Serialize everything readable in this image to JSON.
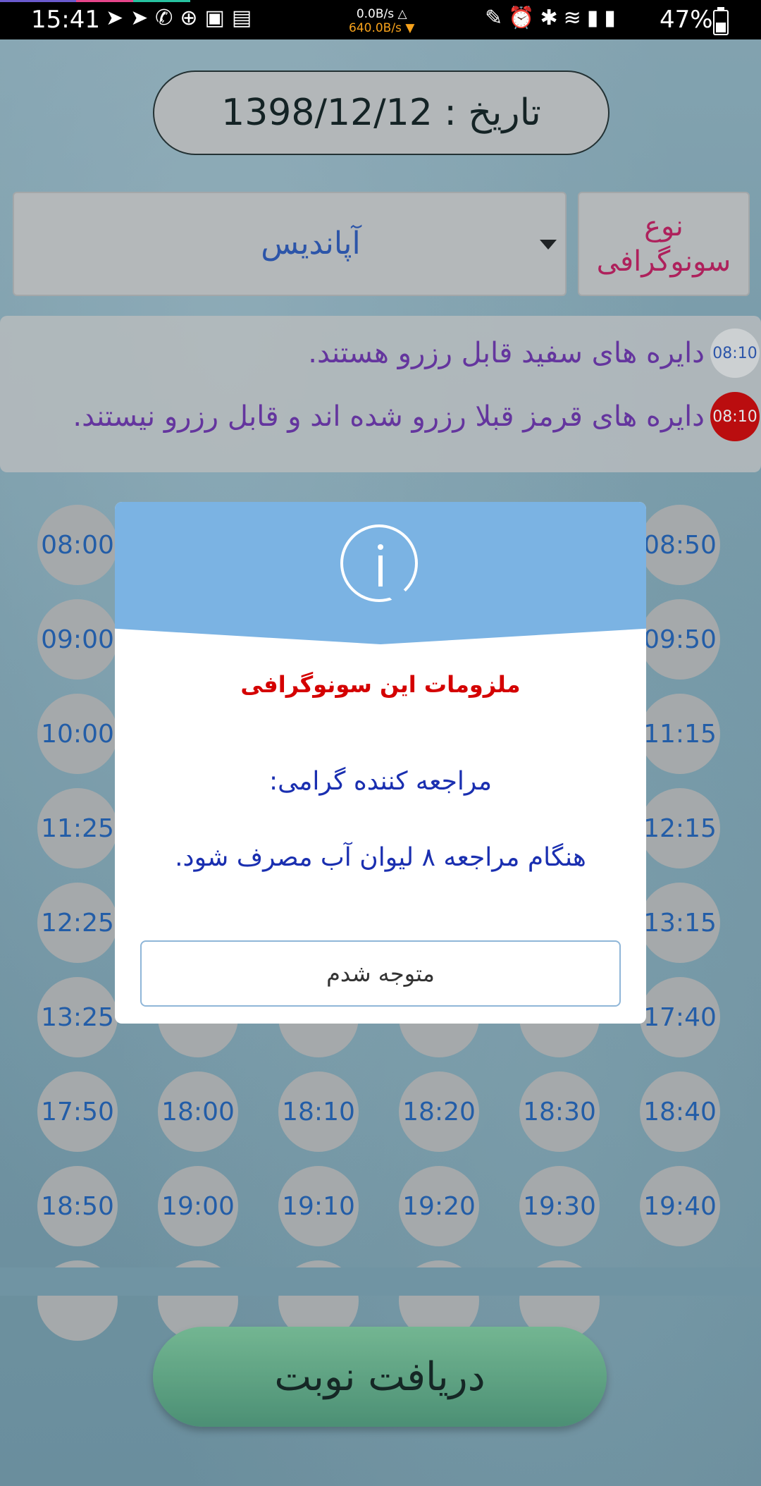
{
  "status_bar": {
    "time": "15:41",
    "left_icons": "➤➤✆⊕▣▤",
    "upload_speed": "0.0B/s △",
    "download_speed": "640.0B/s ▼",
    "right_icons": "✎⏰✱≋▮▮",
    "battery": "47%"
  },
  "header": {
    "date_label": "تاریخ : 1398/12/12"
  },
  "selector": {
    "type_label_line1": "نوع",
    "type_label_line2": "سونوگرافی",
    "selected_value": "آپاندیس"
  },
  "legend": {
    "white_sample_time": "08:10",
    "white_text": "دایره های سفید قابل رزرو هستند.",
    "red_sample_time": "08:10",
    "red_text": "دایره های قرمز قبلا رزرو شده اند و قابل رزرو نیستند.",
    "colors": {
      "available": "#e6e6e6",
      "reserved": "#d10000"
    }
  },
  "time_slots": [
    [
      "08:00",
      "",
      "",
      "",
      "",
      "08:50"
    ],
    [
      "09:00",
      "",
      "",
      "",
      "",
      "09:50"
    ],
    [
      "10:00",
      "",
      "",
      "",
      "",
      "11:15"
    ],
    [
      "11:25",
      "",
      "",
      "",
      "",
      "12:15"
    ],
    [
      "12:25",
      "",
      "",
      "",
      "",
      "13:15"
    ],
    [
      "13:25",
      "",
      "",
      "",
      "",
      "17:40"
    ],
    [
      "17:50",
      "18:00",
      "18:10",
      "18:20",
      "18:30",
      "18:40"
    ],
    [
      "18:50",
      "19:00",
      "19:10",
      "19:20",
      "19:30",
      "19:40"
    ]
  ],
  "cta": {
    "label": "دریافت نوبت"
  },
  "dialog": {
    "title": "ملزومات این سونوگرافی",
    "line1": "مراجعه کننده گرامی:",
    "line2": "هنگام مراجعه ۸ لیوان آب مصرف شود.",
    "button_label": "متوجه شدم",
    "header_color": "#7bb3e3"
  }
}
